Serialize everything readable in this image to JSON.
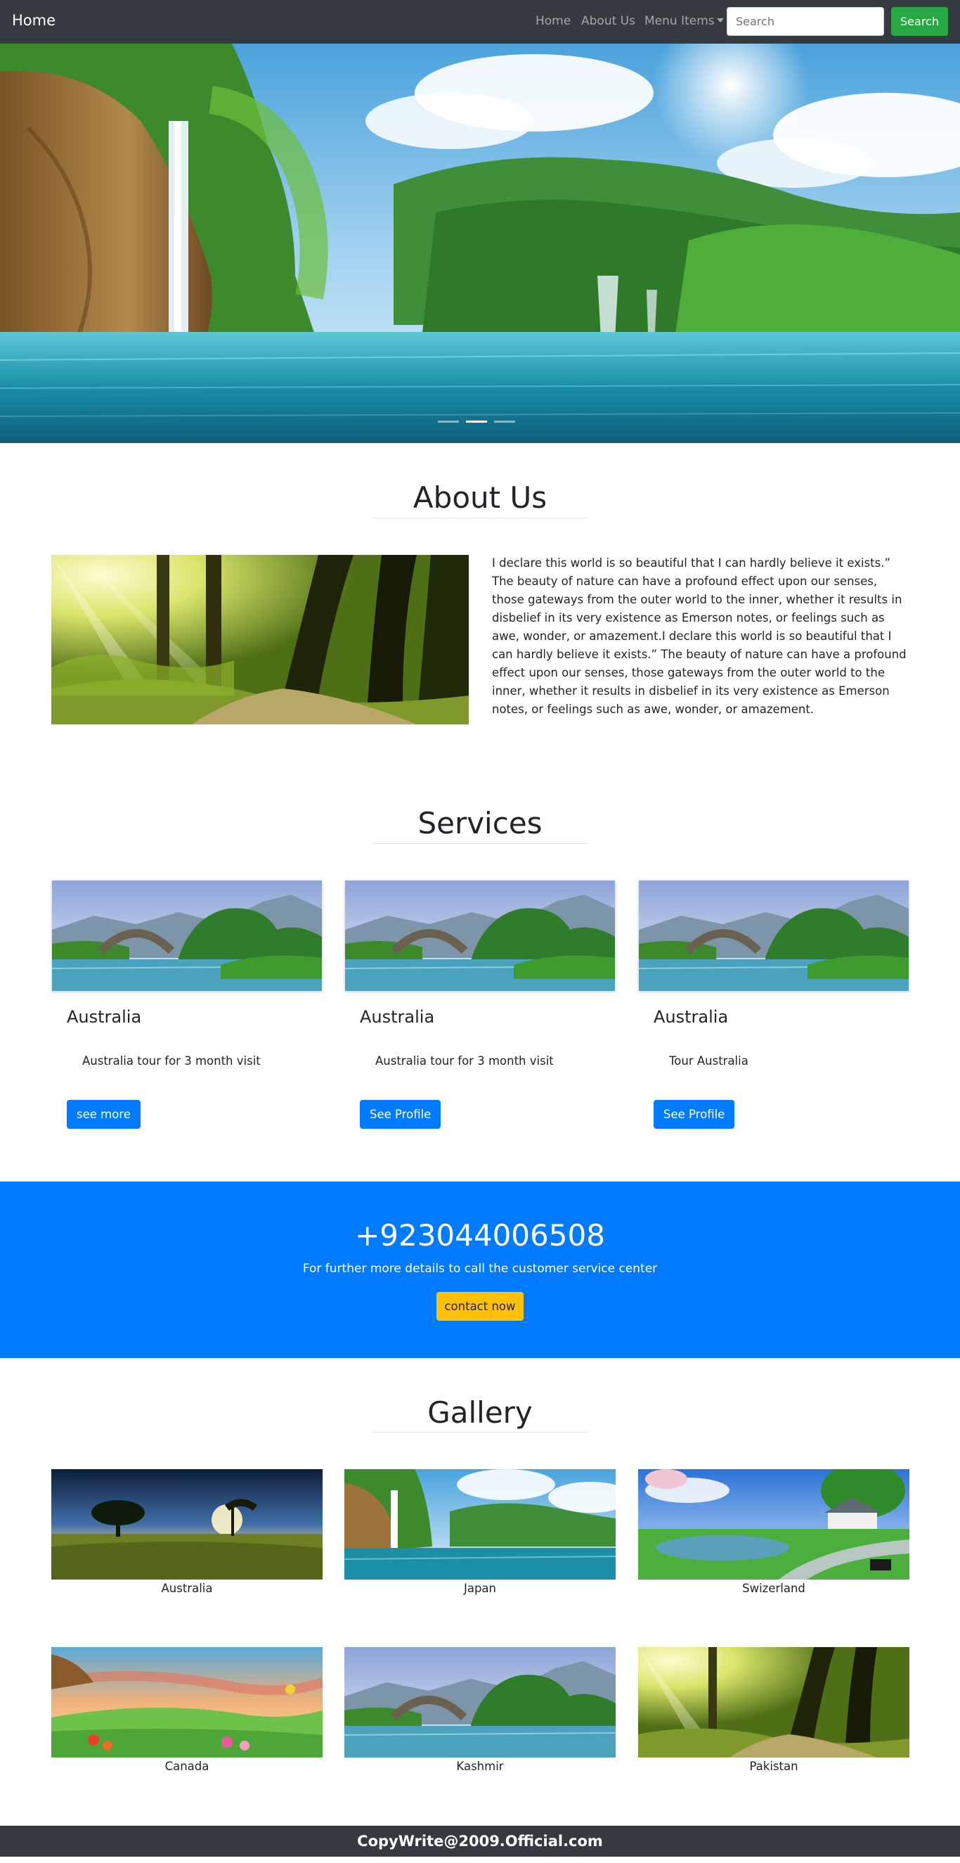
{
  "navbar": {
    "brand": "Home",
    "links": [
      "Home",
      "About Us",
      "Menu Items"
    ],
    "search_placeholder": "Search",
    "search_button": "Search"
  },
  "hero": {
    "image": "waterfall-lake-landscape",
    "slides": 3,
    "active_slide": 1
  },
  "about": {
    "title": "About Us",
    "image": "sunlit-forest-path",
    "paragraph": "I declare this world is so beautiful that I can hardly believe it exists.” The beauty of nature can have a profound effect upon our senses, those gateways from the outer world to the inner, whether it results in disbelief in its very existence as Emerson notes, or feelings such as awe, wonder, or amazement.I declare this world is so beautiful that I can hardly believe it exists.” The beauty of nature can have a profound effect upon our senses, those gateways from the outer world to the inner, whether it results in disbelief in its very existence as Emerson notes, or feelings such as awe, wonder, or amazement."
  },
  "services": {
    "title": "Services",
    "cards": [
      {
        "image": "stone-bridge-river",
        "title": "Australia",
        "text": "Australia tour for 3 month visit",
        "button": "see more"
      },
      {
        "image": "stone-bridge-river",
        "title": "Australia",
        "text": "Australia tour for 3 month visit",
        "button": "See Profile"
      },
      {
        "image": "stone-bridge-river",
        "title": "Australia",
        "text": "Tour Australia",
        "button": "See Profile"
      }
    ]
  },
  "cta": {
    "phone": "+923044006508",
    "subtitle": "For further more details to call the customer service center",
    "button": "contact now"
  },
  "gallery": {
    "title": "Gallery",
    "items": [
      {
        "image": "savanna-sunset-tree",
        "caption": "Australia"
      },
      {
        "image": "waterfall-lake-landscape",
        "caption": "Japan"
      },
      {
        "image": "lakeside-house-garden",
        "caption": "Swizerland"
      },
      {
        "image": "cartoon-meadow-flowers",
        "caption": "Canada"
      },
      {
        "image": "stone-bridge-river",
        "caption": "Kashmir"
      },
      {
        "image": "sunlit-forest-path",
        "caption": "Pakistan"
      }
    ]
  },
  "footer": {
    "text": "CopyWrite@2009.Official.com"
  },
  "colors": {
    "navbar_bg": "#343a40",
    "primary": "#007bff",
    "success": "#28a745",
    "warning": "#ffc107"
  }
}
